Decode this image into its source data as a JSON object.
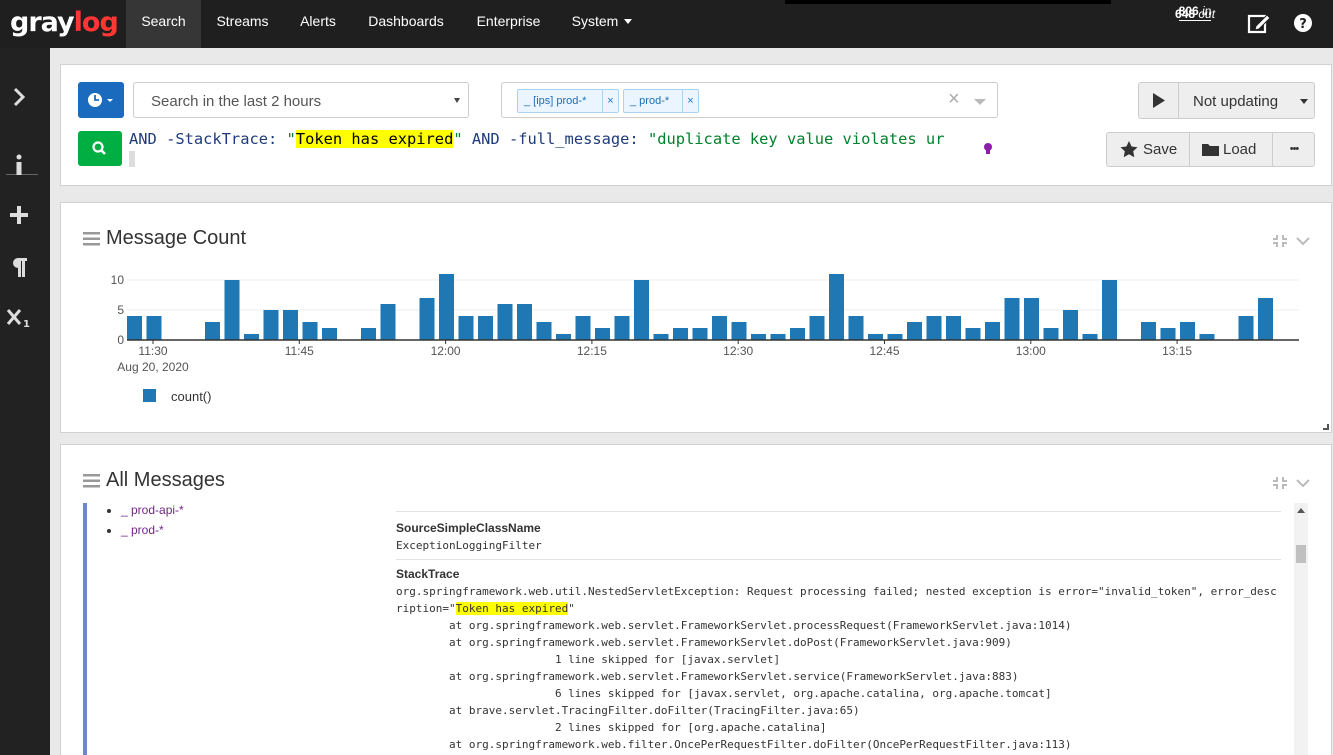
{
  "brand": {
    "gray": "gray",
    "log": "log"
  },
  "nav": {
    "items": [
      "Search",
      "Streams",
      "Alerts",
      "Dashboards",
      "Enterprise",
      "System"
    ]
  },
  "throughput": {
    "in_count": "806",
    "in_label": "in",
    "out_count": "648",
    "out_label": "out"
  },
  "search": {
    "timerange": "Search in the last 2 hours",
    "streams": [
      "_ [ips] prod-*",
      "_ prod-*"
    ],
    "tag_remove": "×",
    "clear": "×",
    "query": {
      "p1": "AND -StackTrace: ",
      "p2": "\"",
      "p3": "Token has expired",
      "p4": "\"",
      "p5": " AND -full_message: ",
      "p6": "\"duplicate key value violates ur"
    },
    "refresh_label": "Not updating",
    "save_label": "Save",
    "load_label": "Load",
    "more_label": "•••"
  },
  "message_count": {
    "title": "Message Count",
    "legend": "count()",
    "date_label": "Aug 20, 2020"
  },
  "chart_data": {
    "type": "bar",
    "title": "Message Count",
    "xlabel": "",
    "ylabel": "",
    "x_ticks": [
      "11:30",
      "11:45",
      "12:00",
      "12:15",
      "12:30",
      "12:45",
      "13:00",
      "13:15"
    ],
    "y_ticks": [
      "0",
      "5",
      "10"
    ],
    "ylim": [
      0,
      12
    ],
    "series": [
      {
        "name": "count()",
        "values": [
          4,
          4,
          0,
          0,
          3,
          10,
          1,
          5,
          5,
          3,
          2,
          0,
          2,
          6,
          0,
          7,
          11,
          4,
          4,
          6,
          6,
          3,
          1,
          4,
          2,
          4,
          10,
          1,
          2,
          2,
          4,
          3,
          1,
          1,
          2,
          4,
          11,
          4,
          1,
          1,
          3,
          4,
          4,
          2,
          3,
          7,
          7,
          2,
          5,
          1,
          10,
          0,
          3,
          2,
          3,
          1,
          0,
          4,
          7
        ]
      }
    ],
    "grid": true,
    "legend": "bottom-left"
  },
  "all_messages": {
    "title": "All Messages",
    "streams": [
      "_ prod-api-*",
      "_ prod-*"
    ],
    "fields": [
      {
        "name": "SourceSimpleClassName",
        "value": "ExceptionLoggingFilter"
      },
      {
        "name": "StackTrace",
        "lines": [
          "org.springframework.web.util.NestedServletException: Request processing failed; nested exception is error=\"invalid_token\", error_desc",
          "ription=\"",
          "Token has expired",
          "\"",
          "        at org.springframework.web.servlet.FrameworkServlet.processRequest(FrameworkServlet.java:1014)",
          "        at org.springframework.web.servlet.FrameworkServlet.doPost(FrameworkServlet.java:909)",
          "                        1 line skipped for [javax.servlet]",
          "        at org.springframework.web.servlet.FrameworkServlet.service(FrameworkServlet.java:883)",
          "                        6 lines skipped for [javax.servlet, org.apache.catalina, org.apache.tomcat]",
          "        at brave.servlet.TracingFilter.doFilter(TracingFilter.java:65)",
          "                        2 lines skipped for [org.apache.catalina]",
          "        at org.springframework.web.filter.OncePerRequestFilter.doFilter(OncePerRequestFilter.java:113)"
        ]
      }
    ]
  }
}
